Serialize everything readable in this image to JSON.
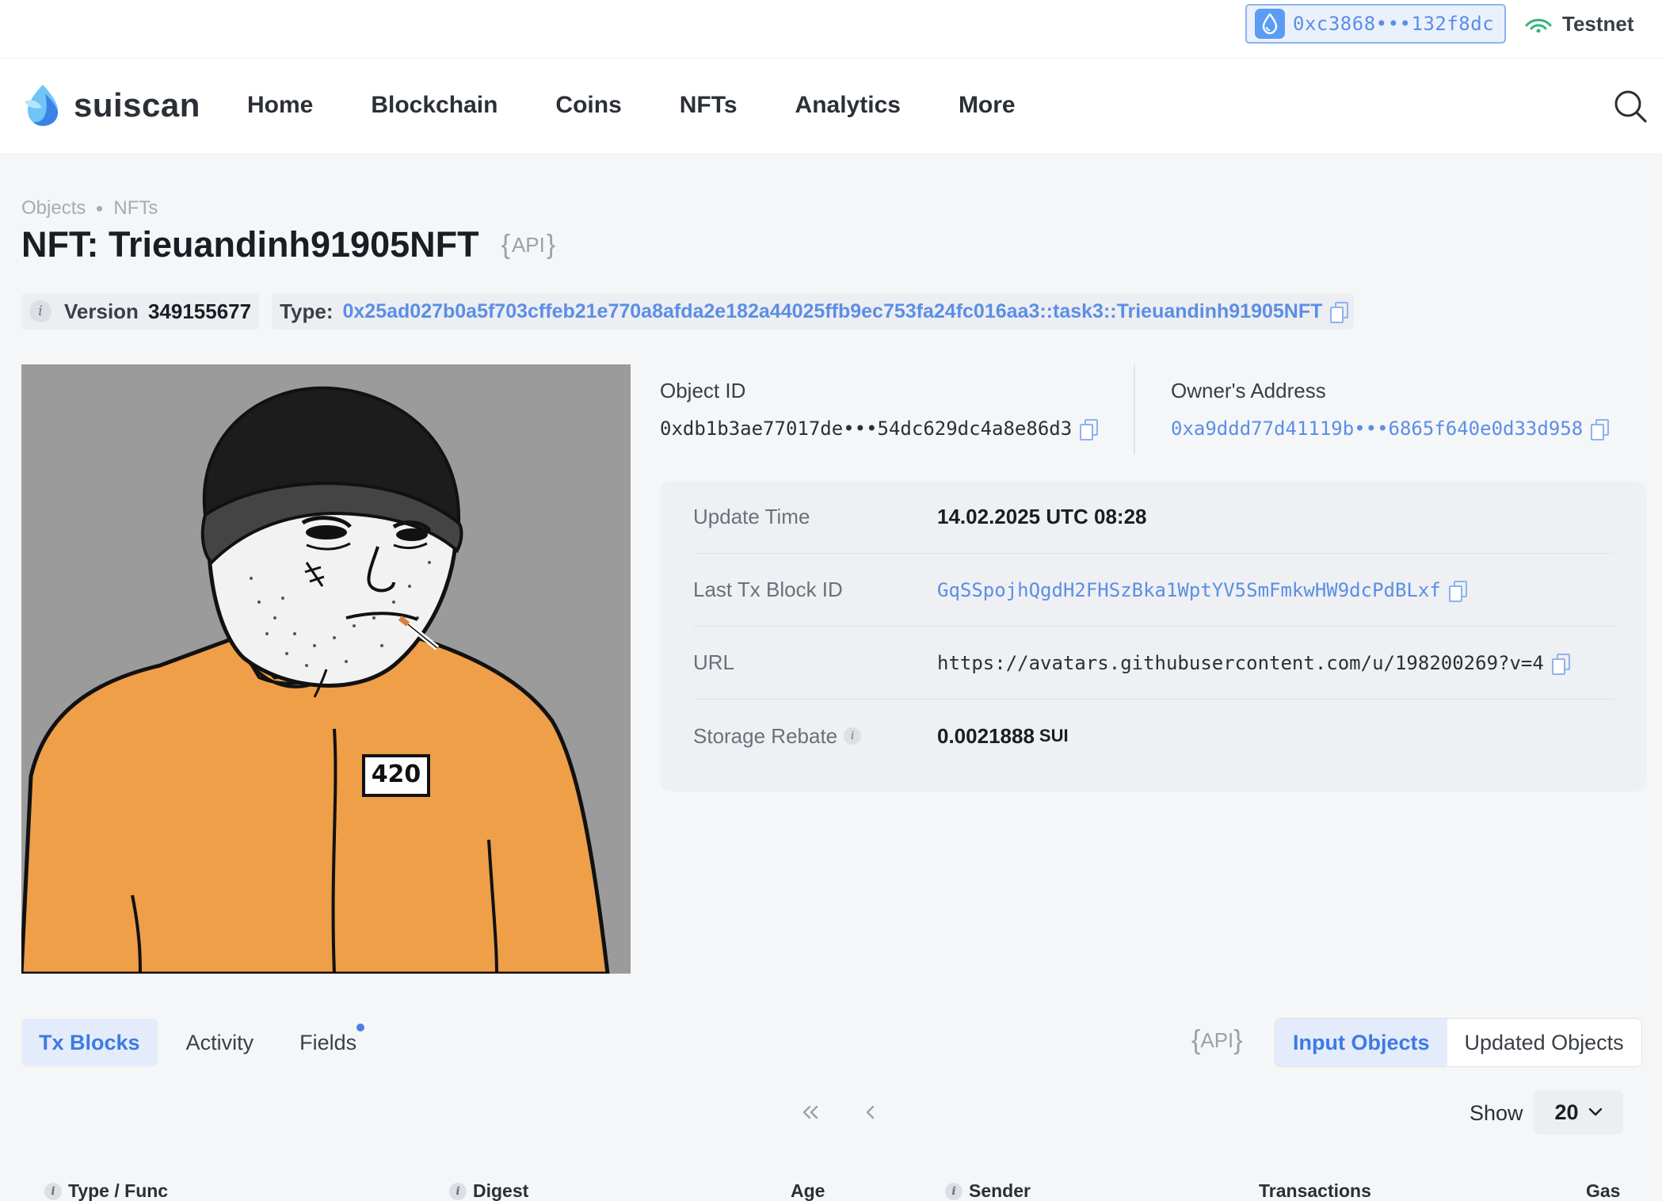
{
  "wallet": {
    "address": "0xc3868•••132f8dc",
    "icon": "drop-icon"
  },
  "network": {
    "label": "Testnet",
    "icon": "signal-icon",
    "color": "#37b37e"
  },
  "brand": {
    "name": "suiscan"
  },
  "nav": {
    "items": [
      "Home",
      "Blockchain",
      "Coins",
      "NFTs",
      "Analytics",
      "More"
    ],
    "search_icon": "search-icon"
  },
  "breadcrumb": [
    "Objects",
    "NFTs"
  ],
  "page": {
    "title": "NFT: Trieuandinh91905NFT",
    "api_label": "API"
  },
  "meta": {
    "version_label": "Version",
    "version_value": "349155677",
    "type_label": "Type:",
    "type_value": "0x25ad027b0a5f703cffeb21e770a8afda2e182a44025ffb9ec753fa24fc016aa3::task3::Trieuandinh91905NFT"
  },
  "nft_image": {
    "badge_text": "420"
  },
  "object_id": {
    "label": "Object ID",
    "value": "0xdb1b3ae77017de•••54dc629dc4a8e86d3"
  },
  "owner": {
    "label": "Owner's Address",
    "value": "0xa9ddd77d41119b•••6865f640e0d33d958"
  },
  "details": {
    "update_time_label": "Update Time",
    "update_time_value": "14.02.2025 UTC 08:28",
    "last_tx_label": "Last Tx Block ID",
    "last_tx_value": "GqSSpojhQgdH2FHSzBka1WptYV5SmFmkwHW9dcPdBLxf",
    "url_label": "URL",
    "url_value": "https://avatars.githubusercontent.com/u/198200269?v=4",
    "storage_label": "Storage Rebate",
    "storage_value": "0.0021888",
    "storage_unit": "SUI"
  },
  "tabs": [
    "Tx Blocks",
    "Activity",
    "Fields"
  ],
  "tabs_api_label": "API",
  "segment": [
    "Input Objects",
    "Updated Objects"
  ],
  "pagination": {
    "show_label": "Show",
    "page_size": "20"
  },
  "table": {
    "columns": [
      "Type / Func",
      "Digest",
      "Age",
      "Sender",
      "Transactions",
      "Gas"
    ]
  },
  "colors": {
    "accent": "#3d7be3",
    "link": "#5b8ee6",
    "shirt": "#ee9f48"
  }
}
